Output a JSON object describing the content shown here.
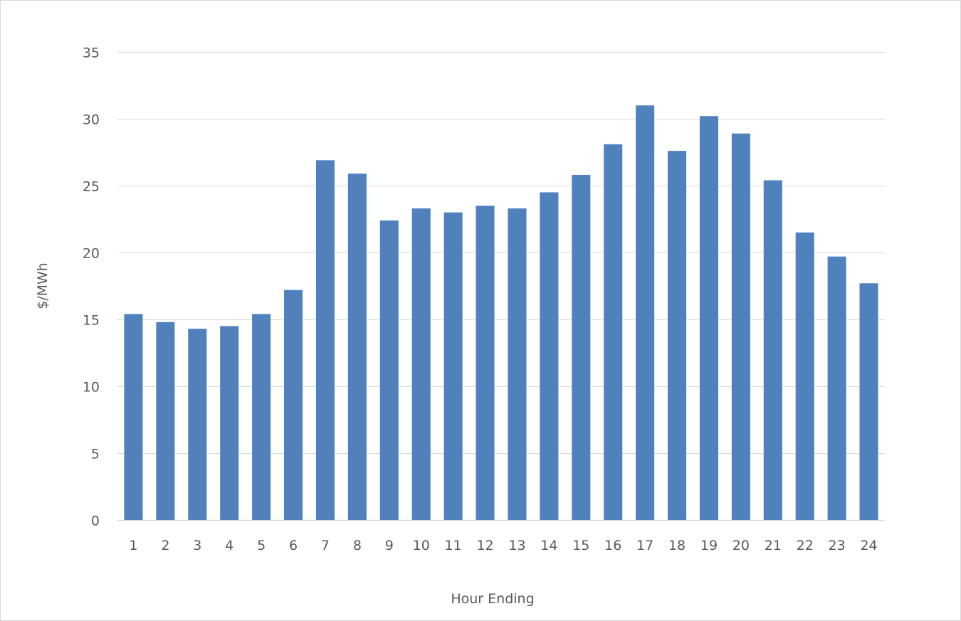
{
  "chart_data": {
    "type": "bar",
    "title": "",
    "xlabel": "Hour Ending",
    "ylabel": "$/MWh",
    "ylim": [
      0,
      35
    ],
    "yticks": [
      0,
      5,
      10,
      15,
      20,
      25,
      30,
      35
    ],
    "grid": true,
    "legend": "none",
    "categories": [
      "1",
      "2",
      "3",
      "4",
      "5",
      "6",
      "7",
      "8",
      "9",
      "10",
      "11",
      "12",
      "13",
      "14",
      "15",
      "16",
      "17",
      "18",
      "19",
      "20",
      "21",
      "22",
      "23",
      "24"
    ],
    "series": [
      {
        "name": "$/MWh",
        "color": "#4f81bd",
        "values": [
          15.4,
          14.8,
          14.3,
          14.5,
          15.4,
          17.2,
          26.9,
          25.9,
          22.4,
          23.3,
          23.0,
          23.5,
          23.3,
          24.5,
          25.8,
          28.1,
          31.0,
          27.6,
          30.2,
          28.9,
          25.4,
          21.5,
          19.7,
          17.7
        ]
      }
    ]
  }
}
